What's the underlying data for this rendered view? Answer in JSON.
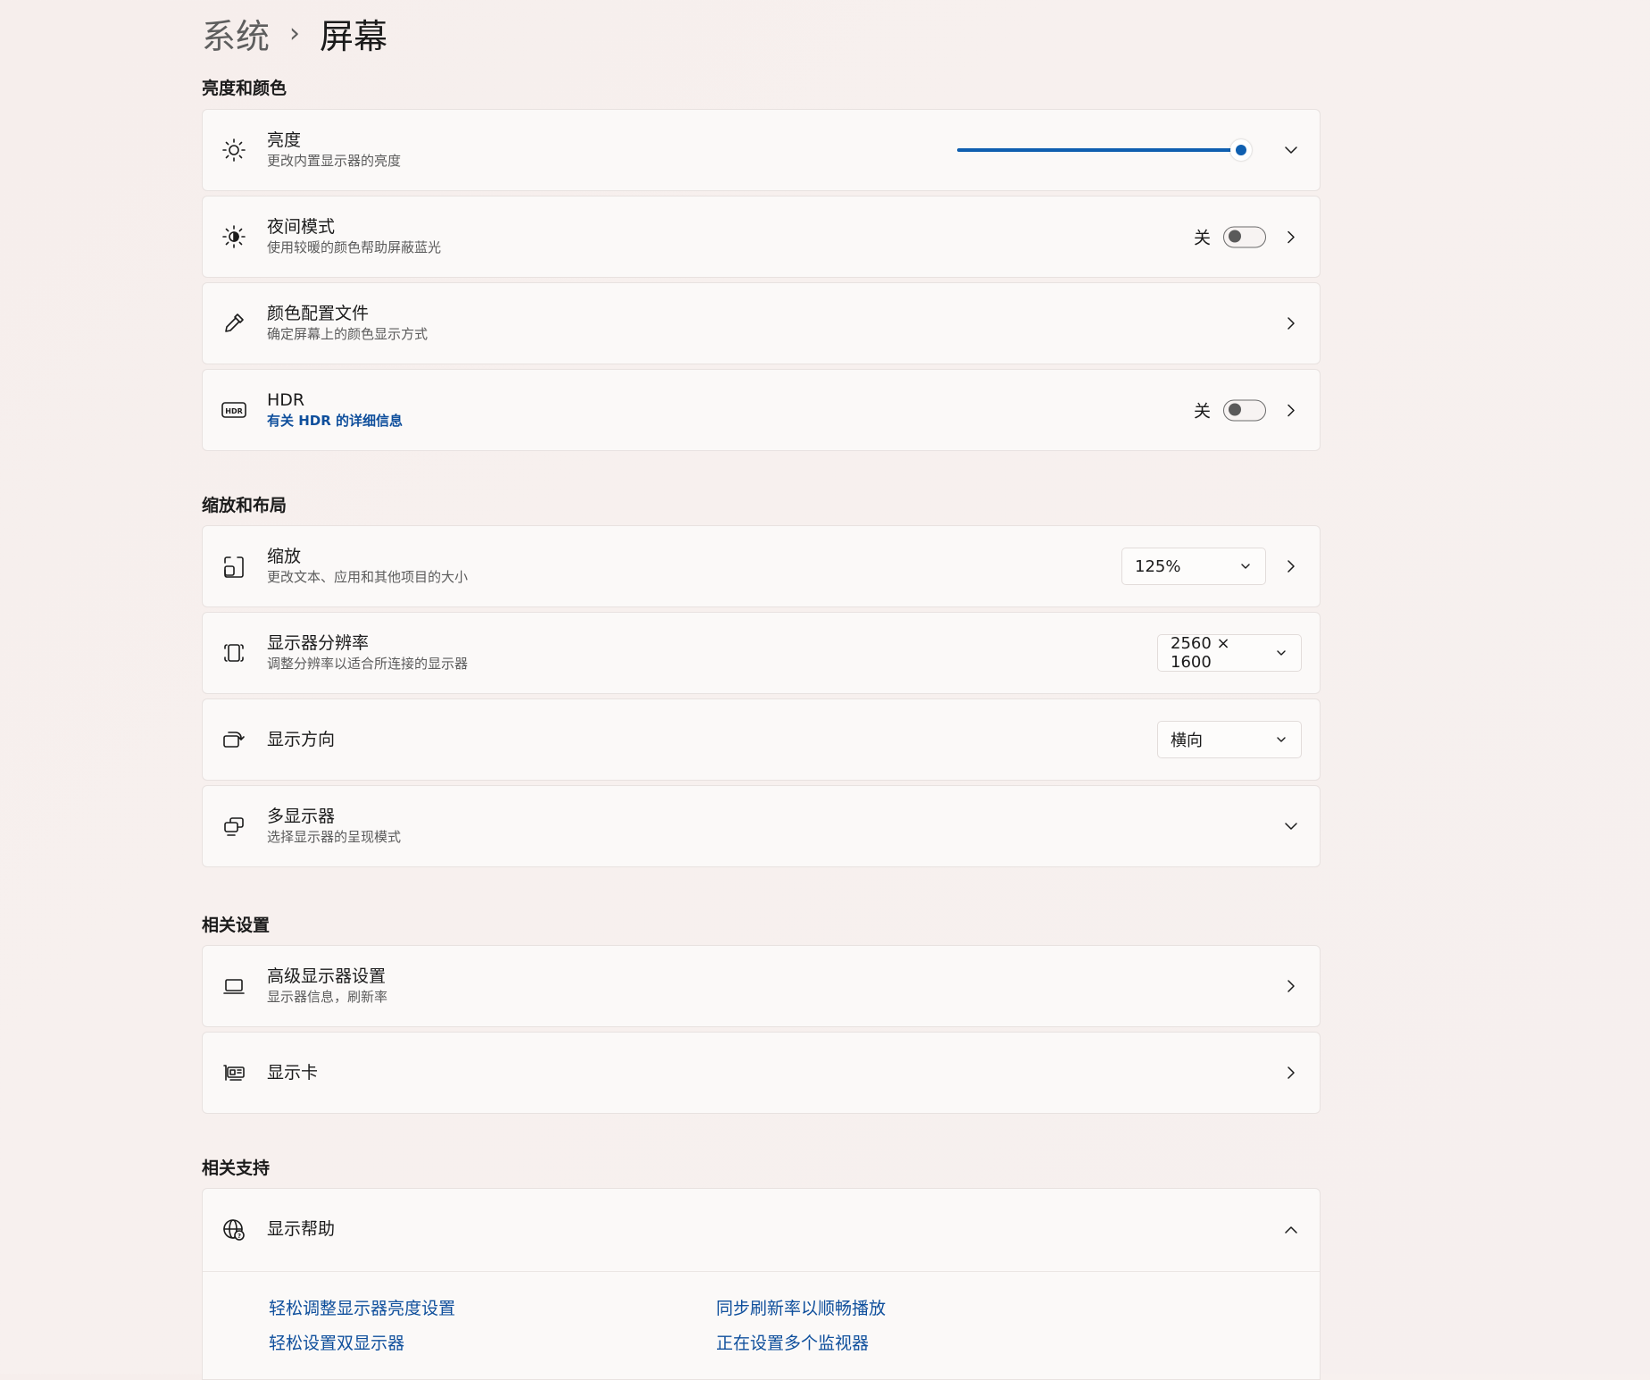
{
  "breadcrumb": {
    "parent": "系统",
    "separator": "›",
    "current": "屏幕"
  },
  "sections": {
    "brightness_color": "亮度和颜色",
    "scale_layout": "缩放和布局",
    "related_settings": "相关设置",
    "related_support": "相关支持"
  },
  "brightness": {
    "title": "亮度",
    "subtitle": "更改内置显示器的亮度",
    "level_percent": 100,
    "accent_color": "#0f5fb0",
    "icon": "sun-icon",
    "expand_icon": "chevron-down-icon"
  },
  "night_light": {
    "title": "夜间模式",
    "subtitle": "使用较暖的颜色帮助屏蔽蓝光",
    "state_label": "关",
    "on": false,
    "icon": "night-light-icon"
  },
  "color_profile": {
    "title": "颜色配置文件",
    "subtitle": "确定屏幕上的颜色显示方式",
    "icon": "eyedropper-icon"
  },
  "hdr": {
    "title": "HDR",
    "link": "有关 HDR 的详细信息",
    "state_label": "关",
    "on": false,
    "icon": "hdr-icon"
  },
  "scale": {
    "title": "缩放",
    "subtitle": "更改文本、应用和其他项目的大小",
    "value": "125%",
    "icon": "scale-icon"
  },
  "resolution": {
    "title": "显示器分辨率",
    "subtitle": "调整分辨率以适合所连接的显示器",
    "value": "2560 × 1600",
    "icon": "resolution-icon"
  },
  "orientation": {
    "title": "显示方向",
    "value": "横向",
    "icon": "rotate-display-icon"
  },
  "multiple_displays": {
    "title": "多显示器",
    "subtitle": "选择显示器的呈现模式",
    "icon": "multiple-displays-icon"
  },
  "advanced_display": {
    "title": "高级显示器设置",
    "subtitle": "显示器信息，刷新率",
    "icon": "laptop-icon"
  },
  "graphics": {
    "title": "显示卡",
    "icon": "graphics-card-icon"
  },
  "display_help": {
    "title": "显示帮助",
    "icon": "globe-help-icon",
    "links": [
      "轻松调整显示器亮度设置",
      "同步刷新率以顺畅播放",
      "轻松设置双显示器",
      "正在设置多个监视器"
    ]
  }
}
